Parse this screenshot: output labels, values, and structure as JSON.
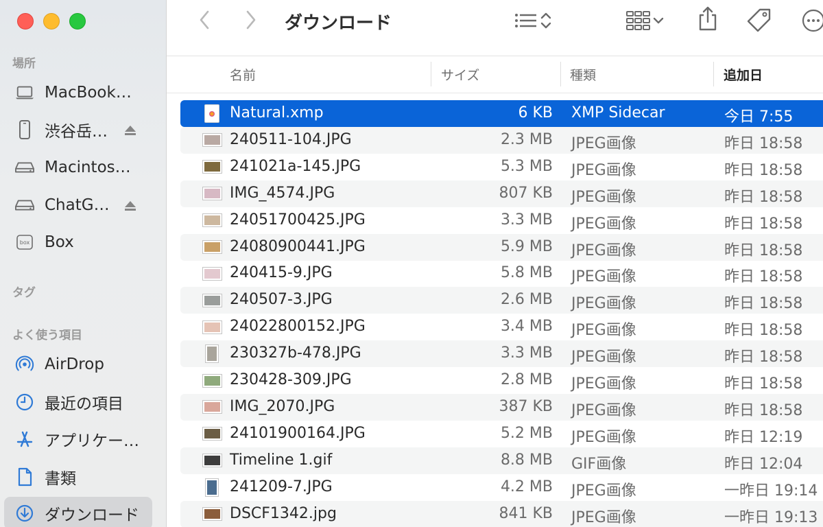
{
  "window": {
    "title": "ダウンロード"
  },
  "sidebar": {
    "sections": {
      "locations": "場所",
      "tags": "タグ",
      "favorites": "よく使う項目"
    },
    "locations": [
      {
        "label": "MacBook…",
        "icon": "laptop-icon"
      },
      {
        "label": "渋谷岳…",
        "icon": "iphone-icon"
      },
      {
        "label": "Macintos…",
        "icon": "disk-icon"
      },
      {
        "label": "ChatG…",
        "icon": "disk-icon"
      },
      {
        "label": "Box",
        "icon": "box-icon"
      }
    ],
    "favorites": [
      {
        "label": "AirDrop",
        "icon": "airdrop-icon"
      },
      {
        "label": "最近の項目",
        "icon": "clock-icon"
      },
      {
        "label": "アプリケー…",
        "icon": "applications-icon"
      },
      {
        "label": "書類",
        "icon": "document-icon"
      },
      {
        "label": "ダウンロード",
        "icon": "download-icon"
      }
    ]
  },
  "columns": {
    "name": "名前",
    "size": "サイズ",
    "kind": "種類",
    "date_added": "追加日"
  },
  "files": [
    {
      "name": "Natural.xmp",
      "size": "6 KB",
      "kind": "XMP Sidecar",
      "date": "今日 7:55",
      "thumb": "doc",
      "selected": true
    },
    {
      "name": "240511-104.JPG",
      "size": "2.3 MB",
      "kind": "JPEG画像",
      "date": "昨日 18:58",
      "thumb": "img",
      "color": "#b9a9a3"
    },
    {
      "name": "241021a-145.JPG",
      "size": "5.3 MB",
      "kind": "JPEG画像",
      "date": "昨日 18:58",
      "thumb": "img",
      "color": "#7e6a3e"
    },
    {
      "name": "IMG_4574.JPG",
      "size": "807 KB",
      "kind": "JPEG画像",
      "date": "昨日 18:58",
      "thumb": "img",
      "color": "#d7b9c4"
    },
    {
      "name": "24051700425.JPG",
      "size": "3.3 MB",
      "kind": "JPEG画像",
      "date": "昨日 18:58",
      "thumb": "img",
      "color": "#cdb89f"
    },
    {
      "name": "24080900441.JPG",
      "size": "5.9 MB",
      "kind": "JPEG画像",
      "date": "昨日 18:58",
      "thumb": "img",
      "color": "#c9a067"
    },
    {
      "name": "240415-9.JPG",
      "size": "5.8 MB",
      "kind": "JPEG画像",
      "date": "昨日 18:58",
      "thumb": "img",
      "color": "#e3c9cf"
    },
    {
      "name": "240507-3.JPG",
      "size": "2.6 MB",
      "kind": "JPEG画像",
      "date": "昨日 18:58",
      "thumb": "img",
      "color": "#9a9d9b"
    },
    {
      "name": "24022800152.JPG",
      "size": "3.4 MB",
      "kind": "JPEG画像",
      "date": "昨日 18:58",
      "thumb": "img",
      "color": "#e5c3b5"
    },
    {
      "name": "230327b-478.JPG",
      "size": "3.3 MB",
      "kind": "JPEG画像",
      "date": "昨日 18:58",
      "thumb": "portrait",
      "color": "#a9a59c"
    },
    {
      "name": "230428-309.JPG",
      "size": "2.8 MB",
      "kind": "JPEG画像",
      "date": "昨日 18:58",
      "thumb": "img",
      "color": "#8faa7c"
    },
    {
      "name": "IMG_2070.JPG",
      "size": "387 KB",
      "kind": "JPEG画像",
      "date": "昨日 18:58",
      "thumb": "img",
      "color": "#d9a79b"
    },
    {
      "name": "24101900164.JPG",
      "size": "5.2 MB",
      "kind": "JPEG画像",
      "date": "昨日 12:19",
      "thumb": "img",
      "color": "#6b5d45"
    },
    {
      "name": "Timeline 1.gif",
      "size": "8.8 MB",
      "kind": "GIF画像",
      "date": "昨日 12:04",
      "thumb": "img",
      "color": "#3d3d3d"
    },
    {
      "name": "241209-7.JPG",
      "size": "4.2 MB",
      "kind": "JPEG画像",
      "date": "一昨日 19:14",
      "thumb": "portrait",
      "color": "#4b6d8f"
    },
    {
      "name": "DSCF1342.jpg",
      "size": "841 KB",
      "kind": "JPEG画像",
      "date": "一昨日 19:13",
      "thumb": "img",
      "color": "#8b5d3b"
    }
  ],
  "colors": {
    "selection": "#0a64d8",
    "accent_icon": "#2f7ad6"
  }
}
